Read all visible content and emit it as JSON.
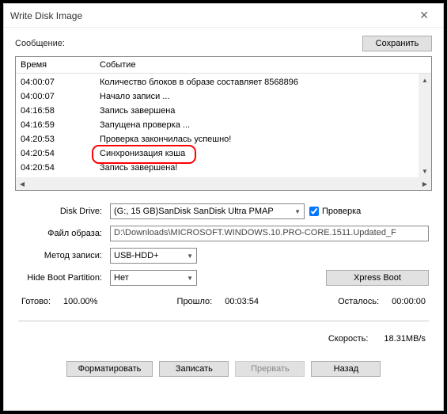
{
  "window": {
    "title": "Write Disk Image",
    "close": "✕"
  },
  "top": {
    "message_label": "Сообщение:",
    "save": "Сохранить"
  },
  "log": {
    "head": {
      "time": "Время",
      "event": "Событие"
    },
    "rows": [
      {
        "t": "04:00:07",
        "e": "Количество блоков в образе составляет 8568896"
      },
      {
        "t": "04:00:07",
        "e": "Начало записи ..."
      },
      {
        "t": "04:16:58",
        "e": "Запись завершена"
      },
      {
        "t": "04:16:59",
        "e": "Запущена проверка ..."
      },
      {
        "t": "04:20:53",
        "e": "Проверка закончилась успешно!"
      },
      {
        "t": "04:20:54",
        "e": "Синхронизация кэша"
      },
      {
        "t": "04:20:54",
        "e": "Запись завершена!"
      }
    ]
  },
  "form": {
    "drive_label": "Disk Drive:",
    "drive_value": "(G:, 15 GB)SanDisk SanDisk Ultra  PMAP",
    "verify_label": "Проверка",
    "image_label": "Файл образа:",
    "image_value": "D:\\Downloads\\MICROSOFT.WINDOWS.10.PRO-CORE.1511.Updated_F",
    "method_label": "Метод записи:",
    "method_value": "USB-HDD+",
    "hidepart_label": "Hide Boot Partition:",
    "hidepart_value": "Нет",
    "xpress": "Xpress Boot"
  },
  "status": {
    "ready": "Готово:",
    "ready_val": "100.00%",
    "elapsed": "Прошло:",
    "elapsed_val": "00:03:54",
    "remain": "Осталось:",
    "remain_val": "00:00:00",
    "speed": "Скорость:",
    "speed_val": "18.31MB/s"
  },
  "buttons": {
    "format": "Форматировать",
    "write": "Записать",
    "abort": "Прервать",
    "back": "Назад"
  }
}
